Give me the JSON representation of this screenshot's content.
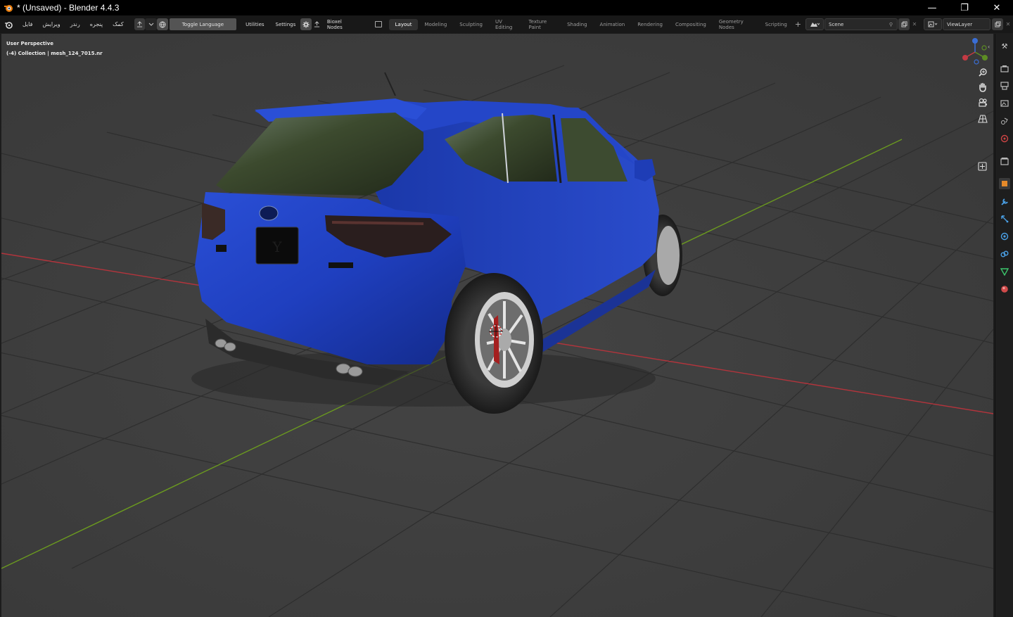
{
  "window": {
    "title": "* (Unsaved) - Blender 4.4.3",
    "minimize": "—",
    "maximize": "❐",
    "close": "✕"
  },
  "menu": {
    "items": [
      "فایل",
      "ویرایش",
      "رندر",
      "پنجره",
      "کمک"
    ]
  },
  "toolbar": {
    "toggle_language": "Toggle Language",
    "utilities": "Utilities",
    "settings": "Settings",
    "bioxel_nodes": "Bioxel Nodes"
  },
  "workspaces": [
    "Layout",
    "Modeling",
    "Sculpting",
    "UV Editing",
    "Texture Paint",
    "Shading",
    "Animation",
    "Rendering",
    "Compositing",
    "Geometry Nodes",
    "Scripting"
  ],
  "active_workspace": "Layout",
  "scene": {
    "name": "Scene",
    "view_layer": "ViewLayer"
  },
  "viewport": {
    "mode": "User Perspective",
    "collection_info": "(-4) Collection | mesh_124_7015.nr",
    "plate_text": "Y"
  },
  "colors": {
    "accent": "#4772b3",
    "car_body": "#1f3fbf",
    "x_axis": "#c3353f",
    "y_axis": "#6b9a1f"
  }
}
